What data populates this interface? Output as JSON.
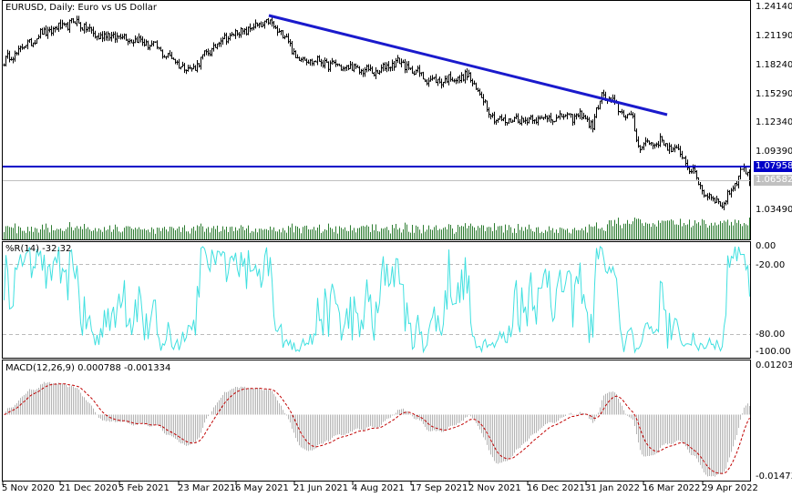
{
  "header": {
    "title": "EURUSD, Daily:  Euro vs US Dollar"
  },
  "wpr": {
    "label": "%R(14) -32.32",
    "levels": [
      "0.00",
      "-20.00",
      "-80.00",
      "-100.00"
    ]
  },
  "macd": {
    "label": "MACD(12,26,9) 0.000788 -0.001334",
    "max": "0.012037",
    "min": "-0.014736"
  },
  "price_axis": [
    "1.24140",
    "1.21190",
    "1.18240",
    "1.15290",
    "1.12340",
    "1.09390",
    "1.03490"
  ],
  "tags": {
    "hline": "1.07958",
    "bid": "1.06582"
  },
  "time_axis": [
    "5 Nov 2020",
    "21 Dec 2020",
    "5 Feb 2021",
    "23 Mar 2021",
    "6 May 2021",
    "21 Jun 2021",
    "4 Aug 2021",
    "17 Sep 2021",
    "2 Nov 2021",
    "16 Dec 2021",
    "31 Jan 2022",
    "16 Mar 2022",
    "29 Apr 2022"
  ],
  "colors": {
    "hline": "#0000c8",
    "trendline": "#1a1acc",
    "wpr": "#40e0e0",
    "volume": "#2e7d32",
    "macd_hist": "#b4b4b4",
    "macd_signal": "#c00000"
  },
  "chart_data": {
    "type": "line",
    "title": "EURUSD, Daily: Euro vs US Dollar",
    "ylim": [
      1.0349,
      1.2414
    ],
    "bars": 410,
    "close_keypoints": [
      [
        0,
        1.185
      ],
      [
        20,
        1.213
      ],
      [
        40,
        1.226
      ],
      [
        50,
        1.212
      ],
      [
        65,
        1.211
      ],
      [
        80,
        1.203
      ],
      [
        102,
        1.176
      ],
      [
        120,
        1.209
      ],
      [
        145,
        1.225
      ],
      [
        155,
        1.21
      ],
      [
        160,
        1.19
      ],
      [
        185,
        1.18
      ],
      [
        205,
        1.174
      ],
      [
        215,
        1.186
      ],
      [
        235,
        1.165
      ],
      [
        255,
        1.17
      ],
      [
        270,
        1.125
      ],
      [
        300,
        1.128
      ],
      [
        318,
        1.13
      ],
      [
        323,
        1.12
      ],
      [
        328,
        1.152
      ],
      [
        345,
        1.125
      ],
      [
        348,
        1.1
      ],
      [
        360,
        1.104
      ],
      [
        372,
        1.09
      ],
      [
        385,
        1.05
      ],
      [
        395,
        1.04
      ],
      [
        405,
        1.077
      ],
      [
        409,
        1.0658
      ]
    ],
    "horizontal_line": 1.07958,
    "bid": 1.06582,
    "trendline": {
      "from": [
        "6 May 2021",
        1.232
      ],
      "to": [
        "Mar 2022",
        1.1318
      ]
    }
  }
}
